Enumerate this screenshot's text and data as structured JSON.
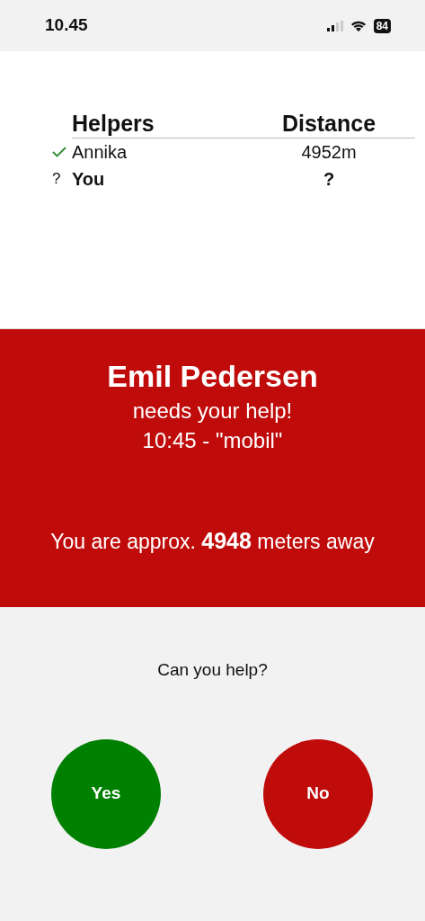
{
  "status_bar": {
    "time": "10.45",
    "battery": "84"
  },
  "helpers_table": {
    "columns": [
      "Helpers",
      "Distance"
    ],
    "rows": [
      {
        "kind": "accepted",
        "name": "Annika",
        "distance": "4952m",
        "is_self": false
      },
      {
        "kind": "pending",
        "marker": "?",
        "name": "You",
        "distance": "?",
        "is_self": true
      }
    ]
  },
  "alert": {
    "name": "Emil Pedersen",
    "message": "needs your help!",
    "detail": "10:45 - \"mobil\"",
    "distance_text": "You are approx. **4948** meters away"
  },
  "prompt": "Can you help?",
  "buttons": [
    {
      "label": "Yes",
      "kind": "accept"
    },
    {
      "label": "No",
      "kind": "decline"
    }
  ]
}
